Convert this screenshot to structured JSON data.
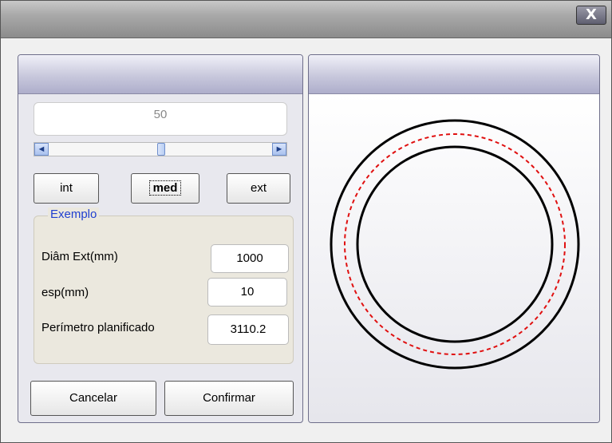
{
  "window": {
    "close_glyph": "X"
  },
  "slider": {
    "value": "50",
    "left_arrow": "◄",
    "right_arrow": "►",
    "position": 0.5
  },
  "buttons": {
    "int": "int",
    "med": "med",
    "ext": "ext",
    "cancel": "Cancelar",
    "confirm": "Confirmar"
  },
  "group": {
    "title": "Exemplo",
    "fields": [
      {
        "label": "Diâm Ext(mm)",
        "value": "1000"
      },
      {
        "label": "esp(mm)",
        "value": "10"
      },
      {
        "label": "Perímetro planificado",
        "value": "3110.2"
      }
    ]
  },
  "preview": {
    "outer_color": "#000000",
    "middle_color": "#e01010",
    "inner_color": "#000000"
  }
}
